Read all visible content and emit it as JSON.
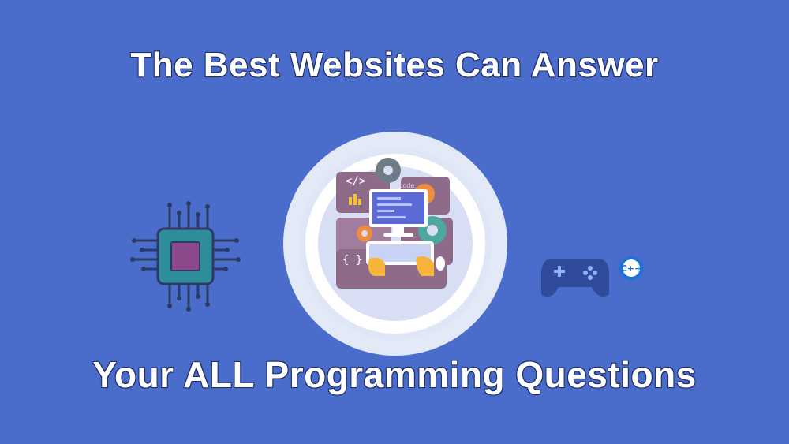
{
  "headline_top": "The Best Websites Can Answer",
  "headline_bottom": "Your ALL Programming Questions",
  "illustration": {
    "code_tag": "</>",
    "code_word": "code",
    "braces": "{ }",
    "cpp_label": "C++"
  },
  "icons": [
    "circuit-chip-icon",
    "developer-workstation-icon",
    "gamepad-icon",
    "cpp-logo-icon"
  ],
  "colors": {
    "background": "#4a6ccb",
    "headline_text": "#ffffff",
    "panel_purple": "#8f6b8a",
    "gear_orange": "#f08c3c",
    "gear_teal": "#4fa8a0",
    "gamepad": "#2f4b9a"
  }
}
